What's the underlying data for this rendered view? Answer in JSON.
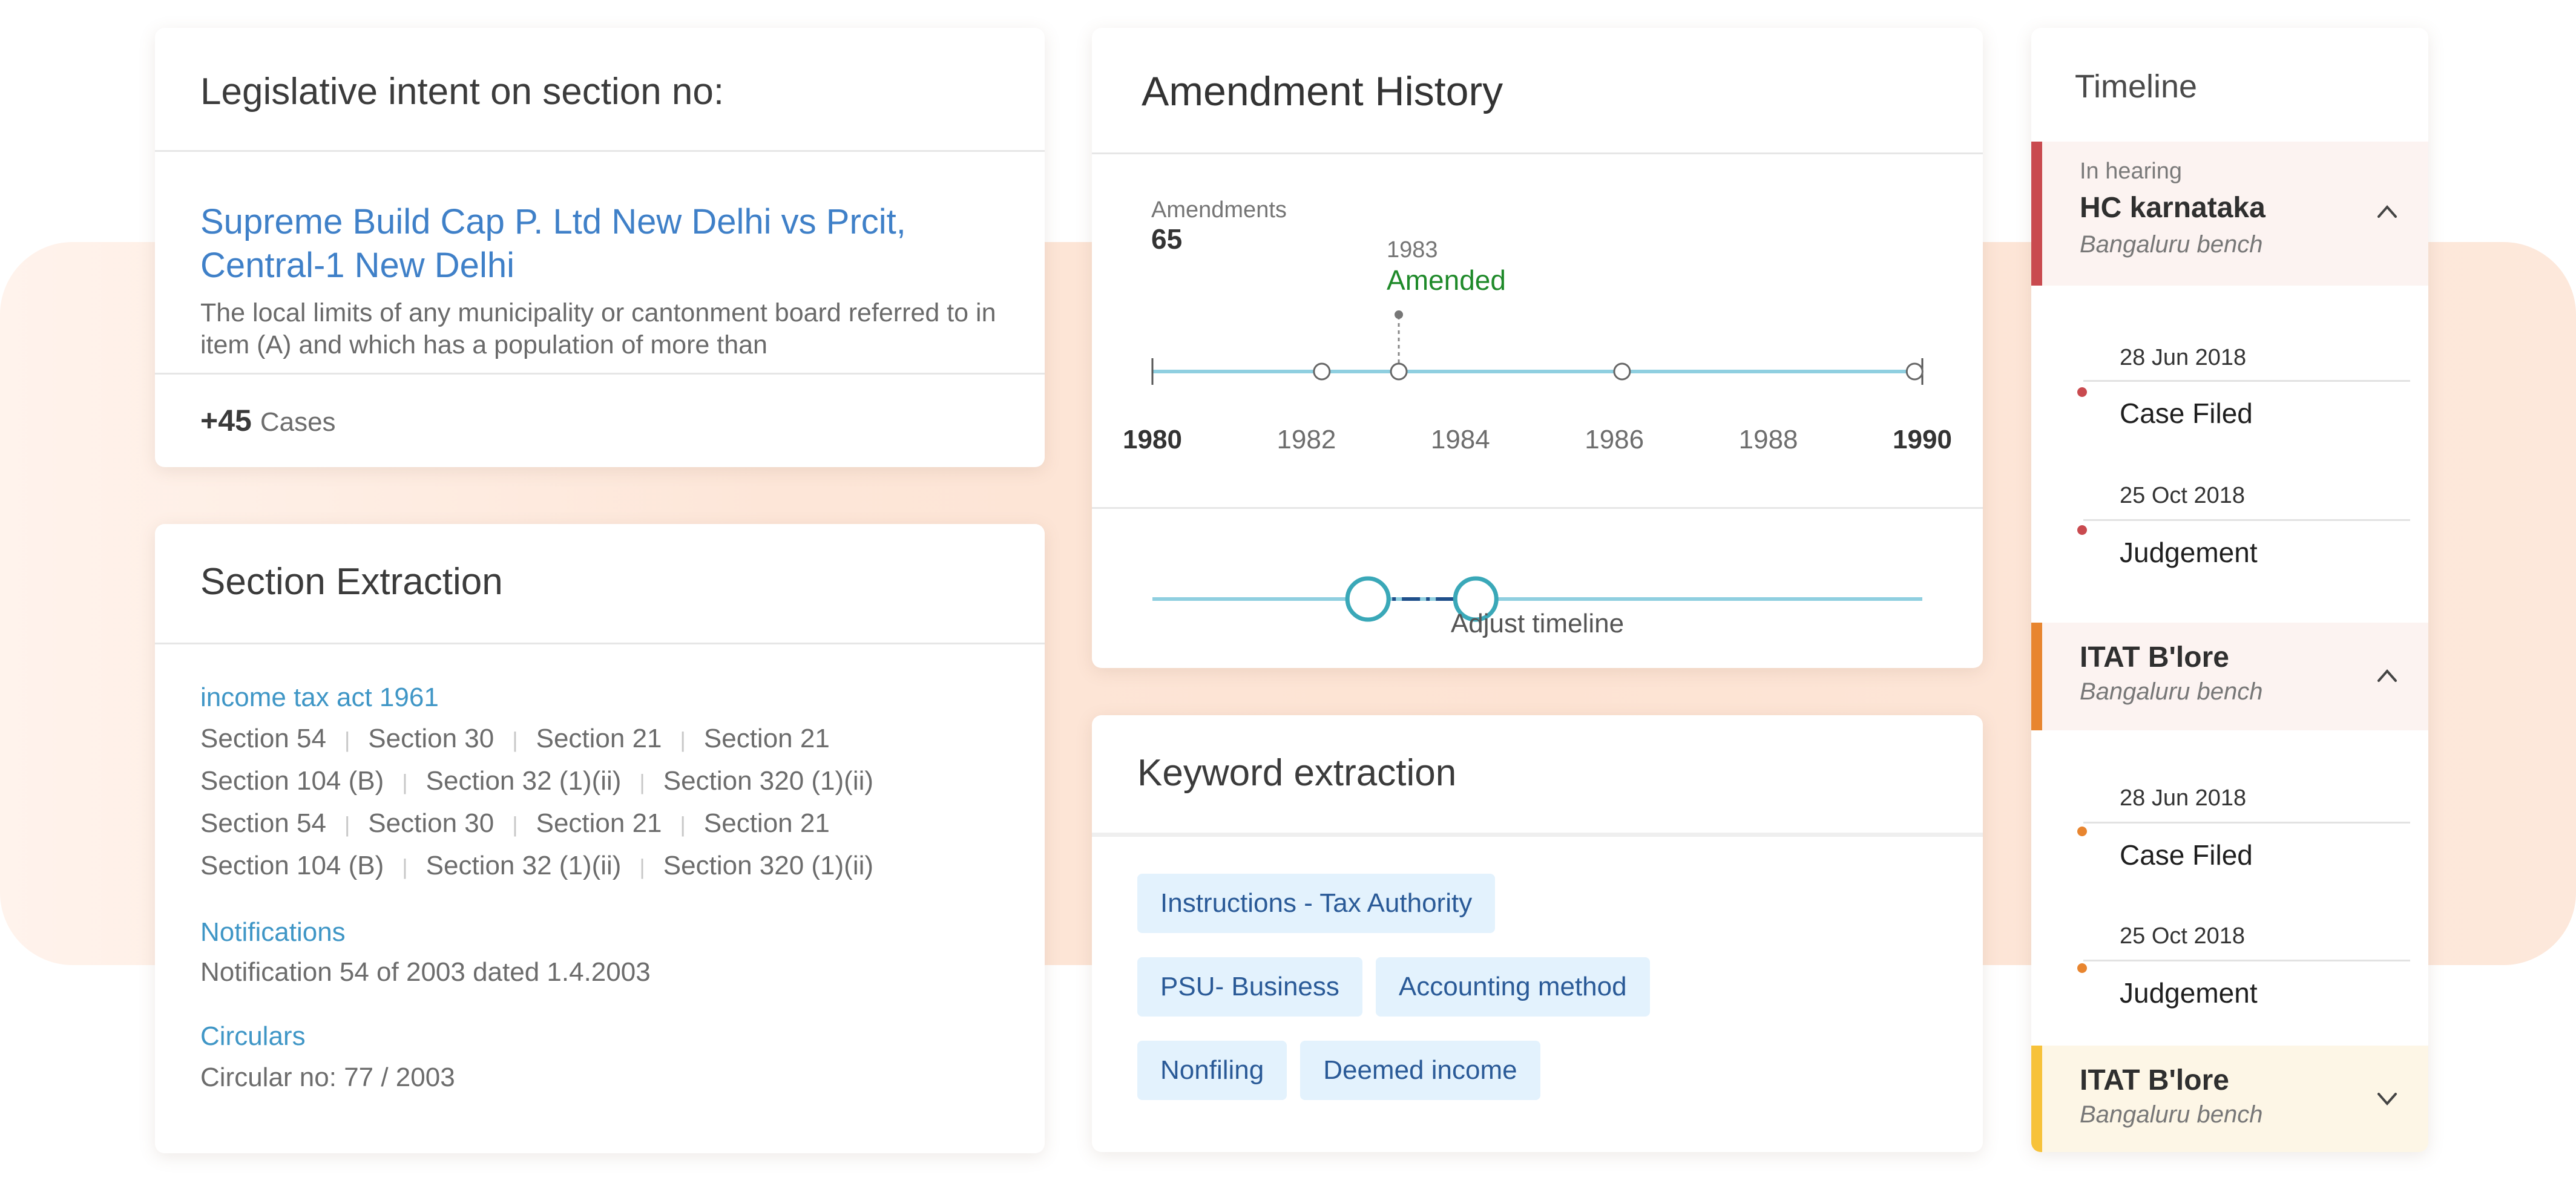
{
  "legislative": {
    "title": "Legislative intent on section no:",
    "case_title": "Supreme Build Cap P. Ltd New Delhi vs Prcit, Central-1 New Delhi",
    "description": "The local limits of any municipality or cantonment board referred to in item (A) and which has a population of more than",
    "cases_count": "+45",
    "cases_label": "Cases"
  },
  "section_extraction": {
    "title": "Section Extraction",
    "act": "income tax act 1961",
    "rows": [
      [
        "Section 54",
        "Section 30",
        "Section 21",
        "Section 21"
      ],
      [
        "Section 104 (B)",
        "Section 32 (1)(ii)",
        "Section 320 (1)(ii)"
      ],
      [
        "Section 54",
        "Section 30",
        "Section 21",
        "Section 21"
      ],
      [
        "Section 104 (B)",
        "Section 32 (1)(ii)",
        "Section 320 (1)(ii)"
      ]
    ],
    "notifications_label": "Notifications",
    "notification_text": "Notification 54 of 2003 dated 1.4.2003",
    "circulars_label": "Circulars",
    "circular_text": "Circular no: 77 / 2003"
  },
  "amendment_history": {
    "title": "Amendment History",
    "amendments_label": "Amendments",
    "amendments_count": "65",
    "highlight_year": "1983",
    "highlight_status": "Amended",
    "year_min": 1980,
    "year_max": 1990,
    "amendment_points": [
      1982.2,
      1983.2,
      1986.1,
      1989.9
    ],
    "axis_years": [
      "1980",
      "1982",
      "1984",
      "1986",
      "1988",
      "1990"
    ],
    "range_selected": [
      1982.8,
      1984.2
    ],
    "adjust_label": "Adjust timeline",
    "colors": {
      "track": "#8fcfe0",
      "handle": "#3aa8b8",
      "selected": "#1f4f8a",
      "amended": "#1f8a2a"
    }
  },
  "keyword_extraction": {
    "title": "Keyword extraction",
    "keywords": [
      "Instructions - Tax Authority",
      "PSU- Business",
      "Accounting method",
      "Nonfiling",
      "Deemed income"
    ]
  },
  "timeline": {
    "title": "Timeline",
    "groups": [
      {
        "status": "In hearing",
        "court": "HC karnataka",
        "bench": "Bangaluru bench",
        "color": "#c94a4f",
        "expanded": true,
        "events": [
          {
            "date": "28 Jun 2018",
            "name": "Case Filed"
          },
          {
            "date": "25 Oct 2018",
            "name": "Judgement"
          }
        ]
      },
      {
        "status": "",
        "court": "ITAT B'lore",
        "bench": "Bangaluru bench",
        "color": "#e8852f",
        "expanded": true,
        "events": [
          {
            "date": "28 Jun 2018",
            "name": "Case Filed"
          },
          {
            "date": "25 Oct 2018",
            "name": "Judgement"
          }
        ]
      },
      {
        "status": "",
        "court": "ITAT B'lore",
        "bench": "Bangaluru bench",
        "color": "#f7c23a",
        "expanded": false,
        "events": []
      }
    ]
  }
}
